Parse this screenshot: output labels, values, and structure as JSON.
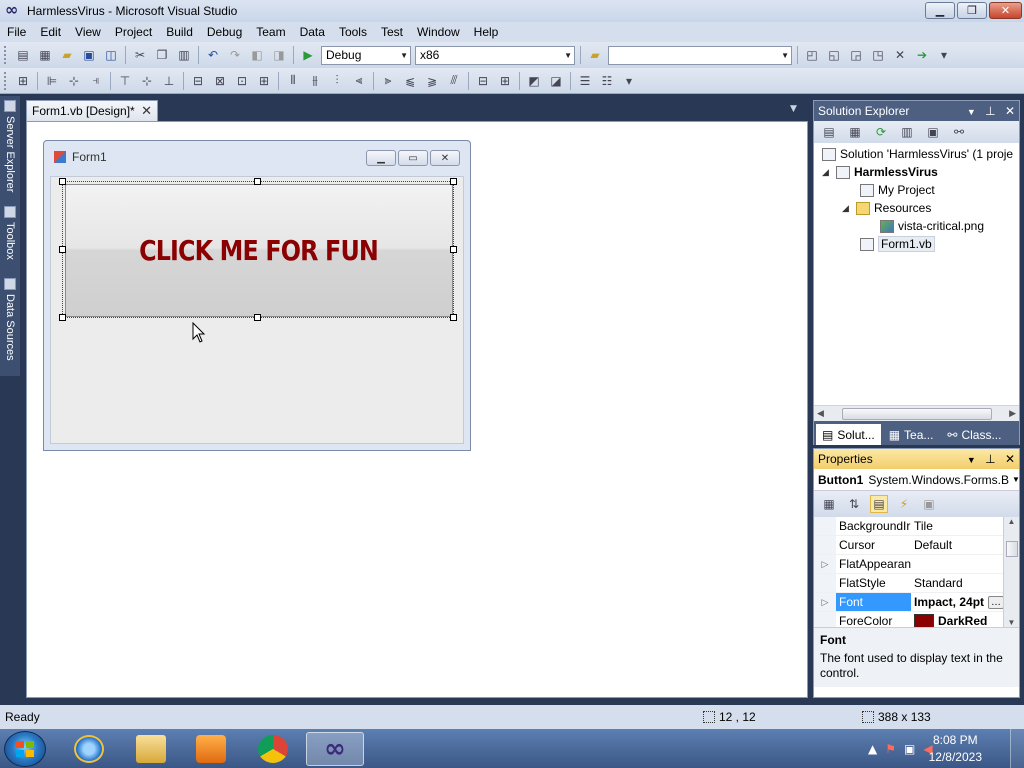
{
  "window": {
    "title": "HarmlessVirus - Microsoft Visual Studio",
    "minimize": "▁",
    "maximize": "❐",
    "close": "✕"
  },
  "menu": [
    "File",
    "Edit",
    "View",
    "Project",
    "Build",
    "Debug",
    "Team",
    "Data",
    "Tools",
    "Test",
    "Window",
    "Help"
  ],
  "toolbar": {
    "config_combo": "Debug",
    "platform_combo": "x86",
    "search_combo": ""
  },
  "sidebar_tabs": {
    "server_explorer": "Server Explorer",
    "toolbox": "Toolbox",
    "data_sources": "Data Sources"
  },
  "document": {
    "tab_label": "Form1.vb [Design]*",
    "form_title": "Form1",
    "button_text": "CLICK ME FOR FUN"
  },
  "solution_explorer": {
    "title": "Solution Explorer",
    "tree": {
      "solution": "Solution 'HarmlessVirus' (1 proje",
      "project": "HarmlessVirus",
      "my_project": "My Project",
      "resources": "Resources",
      "resource_file": "vista-critical.png",
      "form_file": "Form1.vb"
    },
    "tabs": {
      "solution": "Solut...",
      "team": "Tea...",
      "class": "Class..."
    }
  },
  "properties": {
    "title": "Properties",
    "object_name": "Button1",
    "object_type": "System.Windows.Forms.B",
    "rows": [
      {
        "name": "BackgroundIr",
        "value": "Tile"
      },
      {
        "name": "Cursor",
        "value": "Default"
      },
      {
        "name": "FlatAppearan",
        "value": ""
      },
      {
        "name": "FlatStyle",
        "value": "Standard"
      },
      {
        "name": "Font",
        "value": "Impact, 24pt"
      },
      {
        "name": "ForeColor",
        "value": "DarkRed"
      }
    ],
    "desc_title": "Font",
    "desc_text": "The font used to display text in the control."
  },
  "status": {
    "ready": "Ready",
    "position": "12 , 12",
    "size": "388 x 133"
  },
  "taskbar": {
    "time": "8:08 PM",
    "date": "12/8/2023"
  },
  "colors": {
    "button_text": "#8b0000",
    "vs_chrome": "#293955",
    "selection": "#3399ff"
  }
}
